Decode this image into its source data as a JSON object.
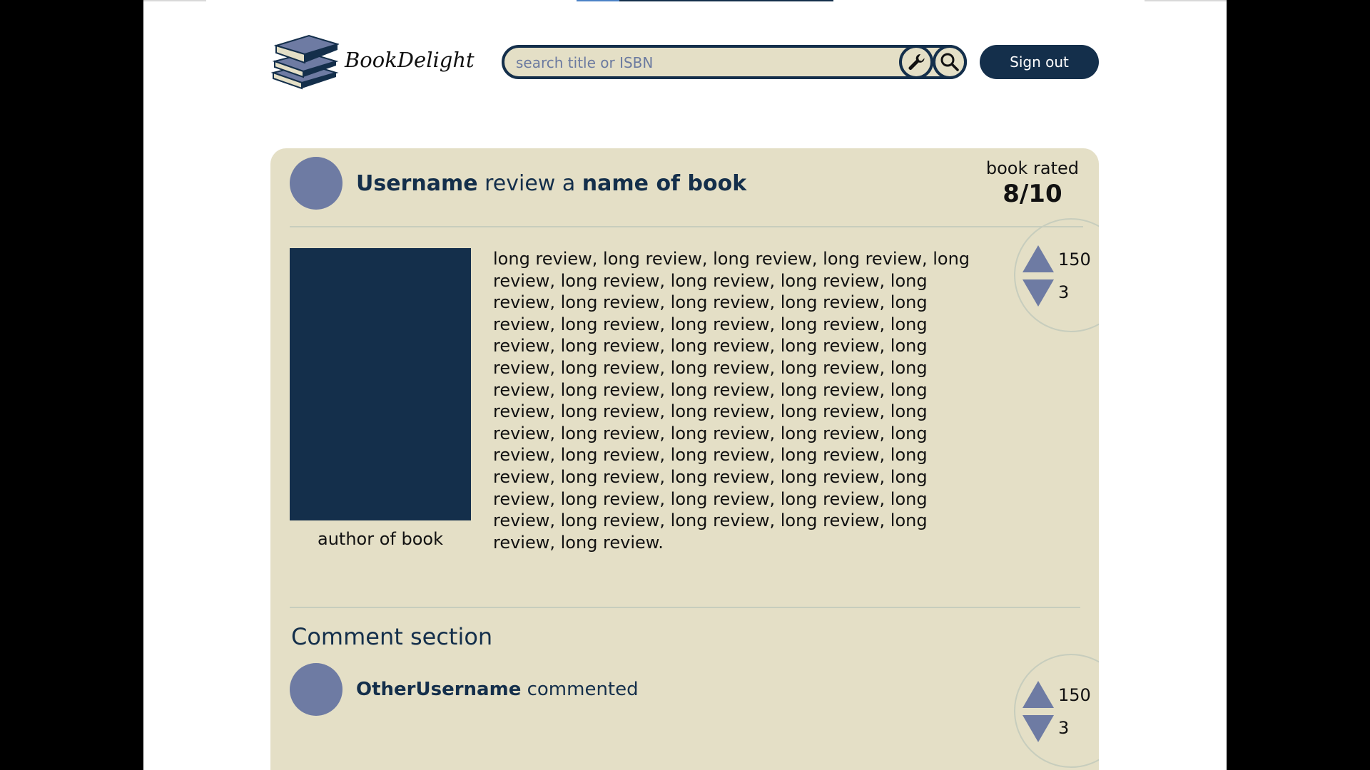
{
  "app": {
    "logo_text": "BookDelight"
  },
  "search": {
    "placeholder": "search title or ISBN",
    "value": ""
  },
  "header": {
    "signout_label": "Sign out"
  },
  "review": {
    "username": "Username",
    "verb": " review a ",
    "book_name": "name of book",
    "rated_label": "book rated",
    "rating": "8/10",
    "author": "author of book",
    "body": "long review, long review, long review, long review, long review, long review, long review, long review, long review, long review, long review, long review, long review, long review, long review, long review, long review, long review, long review, long review, long review, long review, long review, long review, long review, long review, long review, long review, long review, long review, long review, long review, long review, long review, long review, long review, long review, long review, long review, long review, long review, long review, long review, long review, long review, long review, long review, long review, long review, long review, long review, long review, long review, long review.",
    "upvotes": "150",
    "downvotes": "3"
  },
  "comments": {
    "section_title": "Comment section",
    "items": [
      {
        "username": "OtherUsername",
        "action": " commented",
        "upvotes": "150",
        "downvotes": "3"
      }
    ]
  },
  "colors": {
    "navy": "#142f4b",
    "beige": "#e4dfc6",
    "slate": "#6e7ba3"
  }
}
